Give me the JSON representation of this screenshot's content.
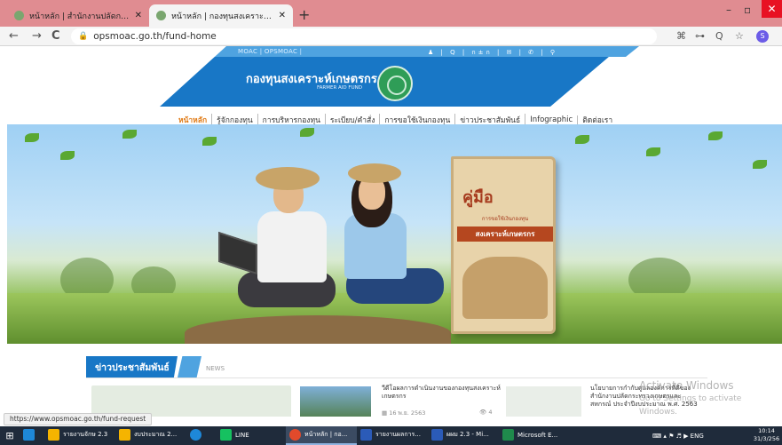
{
  "browser": {
    "tabs": [
      {
        "title": "หน้าหลัก | สำนักงานปลัดกระทรวงเกษ",
        "active": false
      },
      {
        "title": "หน้าหลัก | กองทุนสงเคราะห์เกษตรกร :",
        "active": true
      }
    ],
    "new_tab": "+",
    "url": "opsmoac.go.th/fund-home",
    "nav": {
      "back": "←",
      "forward": "→",
      "reload": "C"
    },
    "toolbar_icons": [
      "⌘",
      "⊶",
      "Q",
      "☆"
    ],
    "profile_initial": "S",
    "window": {
      "minimize": "–",
      "maximize": "▫",
      "close": "✕"
    }
  },
  "site": {
    "util_links": "MOAC  |  OPSMOAC  |",
    "util_icons": "♟ | Q | ก±ก | ✉ | ✆ | ⚲",
    "title": "กองทุนสงเคราะห์เกษตรกร",
    "subtitle": "FARMER AID FUND",
    "nav": [
      {
        "label": "หน้าหลัก",
        "active": true
      },
      {
        "label": "รู้จักกองทุน",
        "active": false
      },
      {
        "label": "การบริหารกองทุน",
        "active": false
      },
      {
        "label": "ระเบียบ/คำสั่ง",
        "active": false
      },
      {
        "label": "การขอใช้เงินกองทุน",
        "active": false
      },
      {
        "label": "ข่าวประชาสัมพันธ์",
        "active": false
      },
      {
        "label": "Infographic",
        "active": false
      },
      {
        "label": "ติดต่อเรา",
        "active": false
      }
    ]
  },
  "banner": {
    "book_title": "คู่มือ",
    "book_sub": "การขอใช้เงินกองทุน",
    "book_sub2": "สงเคราะห์เกษตรกร"
  },
  "news": {
    "heading": "ข่าวประชาสัมพันธ์",
    "heading_en": "NEWS",
    "card2": {
      "title": "วีดีโอผลการดำเนินงานของกองทุนสงเคราะห์เกษตรกร",
      "date": "▦ 16 พ.ย. 2563",
      "views": "👁 4"
    },
    "card3": {
      "title": "นโยบายการกำกับดูแลองค์การที่ดีของสำนักงานปลัดกระทรวงเกษตรและสหกรณ์ ประจำปีงบประมาณ พ.ศ. 2563"
    }
  },
  "overlay": {
    "activate_title": "Activate Windows",
    "activate_sub": "Go to Settings to activate Windows."
  },
  "status_url": "https://www.opsmoac.go.th/fund-request",
  "taskbar": {
    "items": [
      {
        "label": "",
        "color": "#f5b400"
      },
      {
        "label": "รายงานจักษ 2.3",
        "color": "#f5b400"
      },
      {
        "label": "งบประมาณ 2...",
        "color": "#f5b400"
      },
      {
        "label": "",
        "color": "#1e88d8"
      },
      {
        "label": "LINE",
        "color": "#16c160"
      },
      {
        "label": "หน้าหลัก | กอ...",
        "color": "#e24a2b",
        "active": true
      },
      {
        "label": "รายงานผลการ...",
        "color": "#2b5bb8"
      },
      {
        "label": "ผผม 2.3 - Mi...",
        "color": "#2b5bb8"
      },
      {
        "label": "Microsoft E...",
        "color": "#1f8a4c"
      }
    ],
    "tray": "⌨  ▴  ⚑  ♬  ▶  ENG",
    "time": "10:14",
    "date": "31/3/256"
  }
}
